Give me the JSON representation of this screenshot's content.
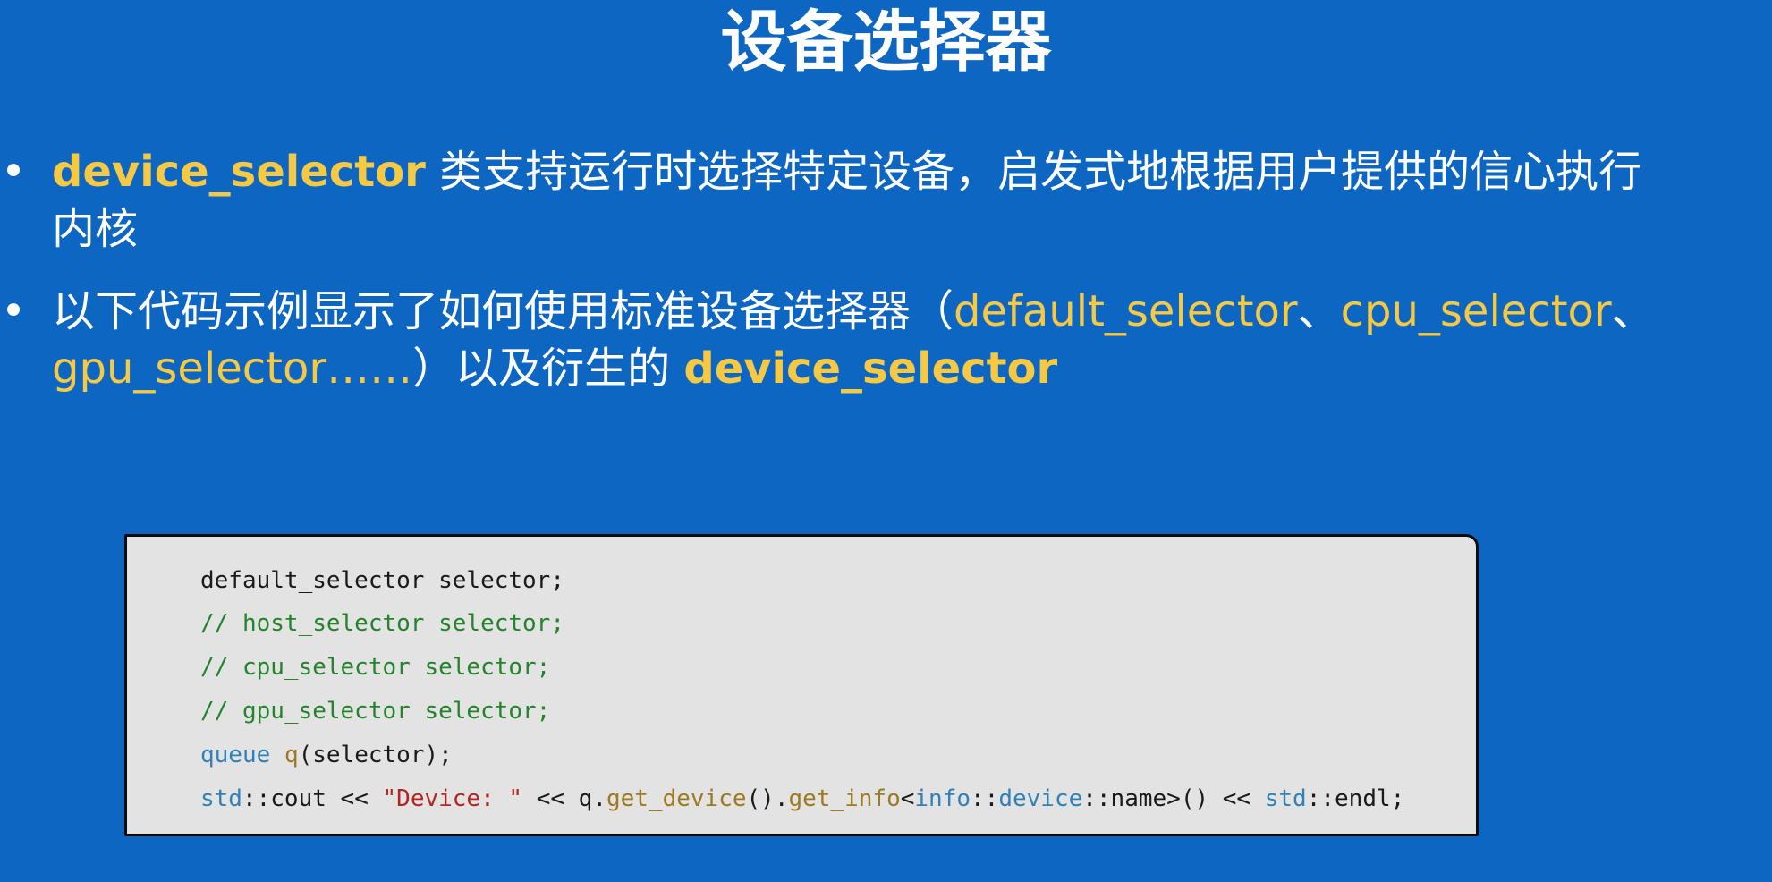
{
  "slide": {
    "title": "设备选择器"
  },
  "bullets": [
    {
      "marker": "•",
      "keyword": "device_selector",
      "text_line1": " 类支持运行时选择特定设备，启发式地根据用户提供的信心执行",
      "text_line2": "内核"
    },
    {
      "marker": "•",
      "text_prefix": "以下代码示例显示了如何使用标准设备选择器（",
      "sel_default": "default_selector",
      "sep1": "、",
      "sel_cpu": "cpu_selector",
      "sep2": "、",
      "sel_gpu": "gpu_selector……",
      "text_middle": "）以及衍生的 ",
      "keyword": "device_selector"
    }
  ],
  "code": {
    "line1": "default_selector selector;",
    "line2": "// host_selector selector;",
    "line3": "// cpu_selector selector;",
    "line4": "// gpu_selector selector;",
    "line5": {
      "type": "queue",
      "sp": " ",
      "fn": "q",
      "arg": "(selector);"
    },
    "line6": {
      "ns1": "std",
      "sep1": "::cout << ",
      "str": "\"Device: \"",
      "mid": " << q.",
      "fn1": "get_device",
      "mid2": "().",
      "fn2": "get_info",
      "lt": "<",
      "ns2": "info",
      "sep2": "::",
      "ns3": "device",
      "tail1": "::name>() << ",
      "ns4": "std",
      "tail2": "::endl;"
    }
  },
  "colors": {
    "background": "#0d66c2",
    "keyword": "#f6c944",
    "code_bg": "#e3e3e3",
    "comment": "#23842b",
    "type": "#2f82b8",
    "string": "#b3261e"
  }
}
